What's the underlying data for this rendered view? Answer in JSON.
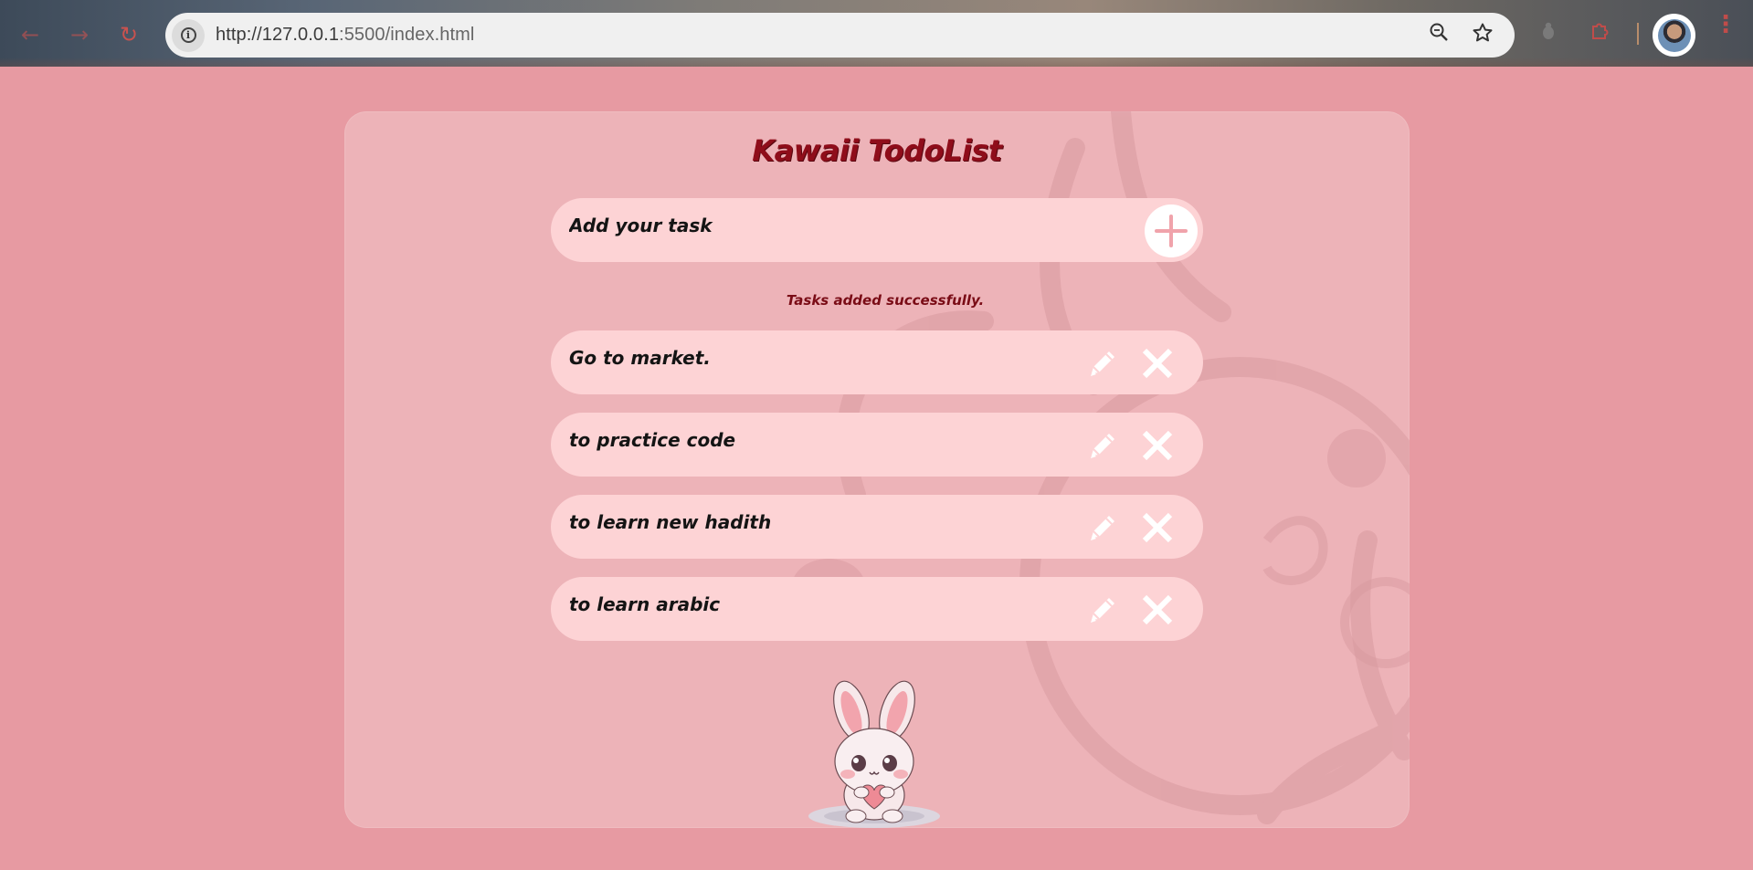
{
  "browser": {
    "url_host": "http://127.0.0.1",
    "url_rest": ":5500/index.html",
    "icons": [
      "back-icon",
      "forward-icon",
      "reload-icon",
      "site-info-icon",
      "zoom-icon",
      "bookmark-star-icon",
      "extension-icon",
      "puzzle-icon",
      "profile-avatar",
      "menu-icon"
    ]
  },
  "app": {
    "title": "Kawaii TodoList",
    "input_placeholder": "Add your task",
    "status_message": "Tasks added successfully.",
    "tasks": [
      {
        "label": "Go to market."
      },
      {
        "label": "to practice code"
      },
      {
        "label": "to learn new hadith"
      },
      {
        "label": "to learn arabic"
      }
    ]
  },
  "colors": {
    "page_background": "#e79aa2",
    "card_background": "#edb3b8",
    "row_background": "#fdd3d5",
    "title": "#8f0d1a",
    "message": "#7a0c16",
    "plus_icon": "#f0a3ab"
  }
}
